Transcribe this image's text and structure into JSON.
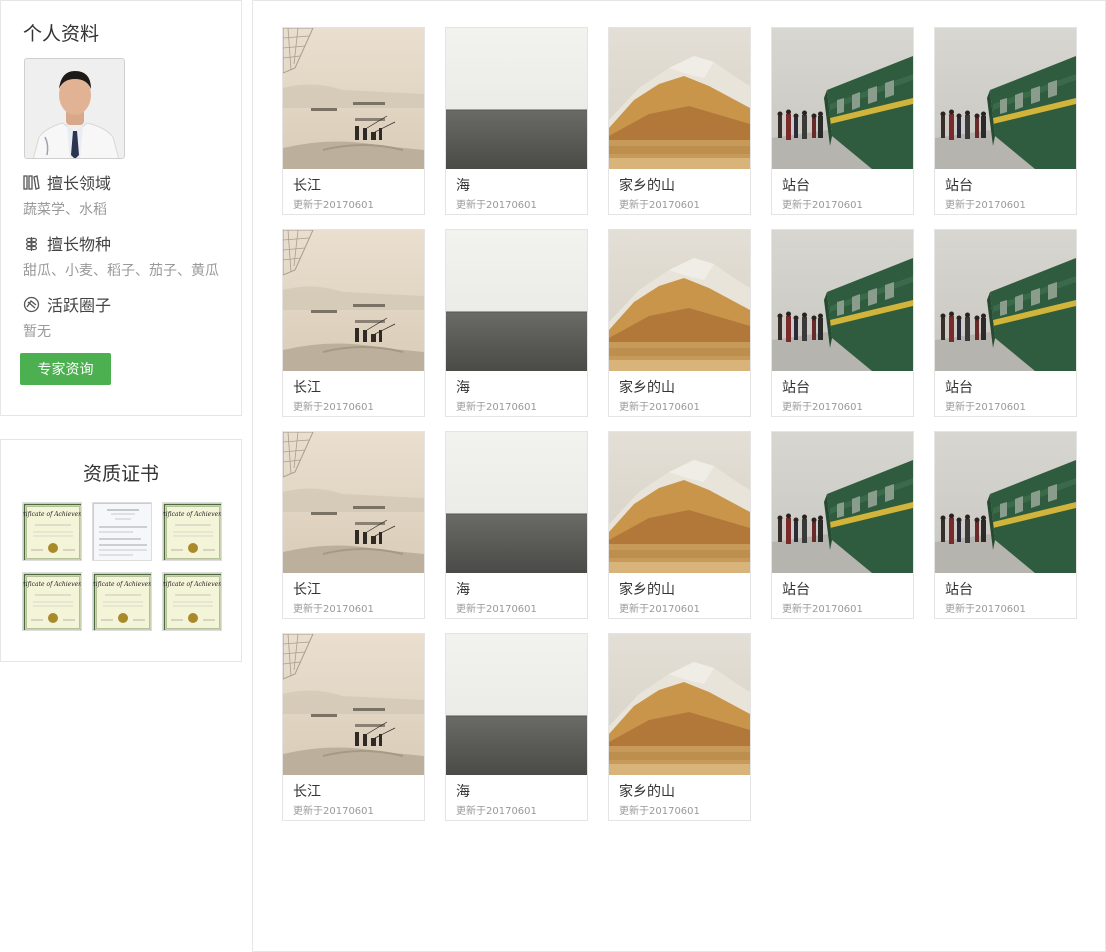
{
  "profile": {
    "title": "个人资料",
    "sections": [
      {
        "icon": "books-icon",
        "label": "擅长领域",
        "value": "蔬菜学、水稻"
      },
      {
        "icon": "plant-icon",
        "label": "擅长物种",
        "value": "甜瓜、小麦、稻子、茄子、黄瓜"
      },
      {
        "icon": "circle-icon",
        "label": "活跃圈子",
        "value": "暂无"
      }
    ],
    "consult_button": "专家资询"
  },
  "certificates": {
    "title": "资质证书",
    "items": [
      "certificate",
      "certificate-letter",
      "certificate",
      "certificate",
      "certificate",
      "certificate"
    ]
  },
  "gallery": {
    "items": [
      {
        "title": "长江",
        "date": "更新于20170601",
        "scene": "river"
      },
      {
        "title": "海",
        "date": "更新于20170601",
        "scene": "sea"
      },
      {
        "title": "家乡的山",
        "date": "更新于20170601",
        "scene": "mountain"
      },
      {
        "title": "站台",
        "date": "更新于20170601",
        "scene": "train"
      },
      {
        "title": "站台",
        "date": "更新于20170601",
        "scene": "train"
      },
      {
        "title": "长江",
        "date": "更新于20170601",
        "scene": "river"
      },
      {
        "title": "海",
        "date": "更新于20170601",
        "scene": "sea"
      },
      {
        "title": "家乡的山",
        "date": "更新于20170601",
        "scene": "mountain"
      },
      {
        "title": "站台",
        "date": "更新于20170601",
        "scene": "train"
      },
      {
        "title": "站台",
        "date": "更新于20170601",
        "scene": "train"
      },
      {
        "title": "长江",
        "date": "更新于20170601",
        "scene": "river"
      },
      {
        "title": "海",
        "date": "更新于20170601",
        "scene": "sea"
      },
      {
        "title": "家乡的山",
        "date": "更新于20170601",
        "scene": "mountain"
      },
      {
        "title": "站台",
        "date": "更新于20170601",
        "scene": "train"
      },
      {
        "title": "站台",
        "date": "更新于20170601",
        "scene": "train"
      },
      {
        "title": "长江",
        "date": "更新于20170601",
        "scene": "river"
      },
      {
        "title": "海",
        "date": "更新于20170601",
        "scene": "sea"
      },
      {
        "title": "家乡的山",
        "date": "更新于20170601",
        "scene": "mountain"
      }
    ]
  },
  "colors": {
    "accent": "#4caf50",
    "border": "#e6e6e6",
    "muted": "#999999"
  }
}
